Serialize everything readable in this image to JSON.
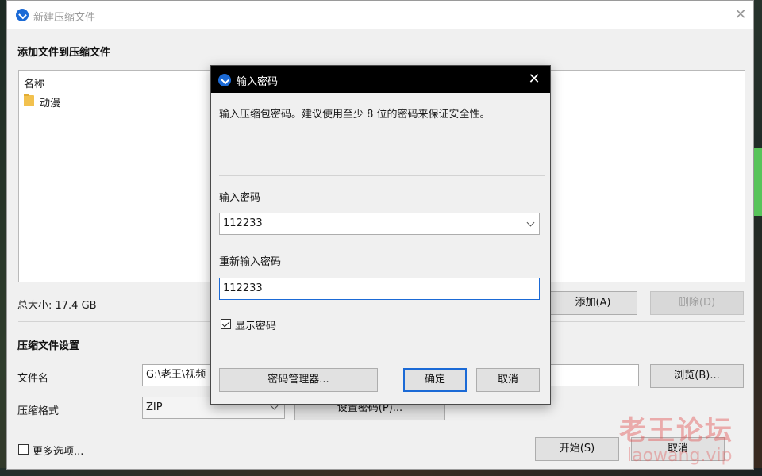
{
  "window": {
    "title": "新建压缩文件",
    "close_glyph": "✕"
  },
  "add_files": {
    "heading": "添加文件到压缩文件",
    "column_name": "名称",
    "items": [
      {
        "name": "动漫",
        "icon": "folder-icon"
      }
    ],
    "total_size": "总大小: 17.4 GB",
    "add_button": "添加(A)",
    "delete_button": "删除(D)"
  },
  "settings": {
    "heading": "压缩文件设置",
    "filename_label": "文件名",
    "filename_value": "G:\\老王\\视频",
    "browse_button": "浏览(B)...",
    "format_label": "压缩格式",
    "format_value": "ZIP",
    "set_password_button": "设置密码(P)...",
    "more_options_label": "更多选项...",
    "more_options_checked": false,
    "start_button": "开始(S)",
    "cancel_button": "取消"
  },
  "password_dialog": {
    "title": "输入密码",
    "close_glyph": "✕",
    "hint": "输入压缩包密码。建议使用至少 8 位的密码来保证安全性。",
    "password_label": "输入密码",
    "password_value": "112233",
    "confirm_label": "重新输入密码",
    "confirm_value": "112233",
    "show_password_label": "显示密码",
    "show_password_checked": true,
    "manager_button": "密码管理器...",
    "ok_button": "确定",
    "cancel_button": "取消"
  },
  "watermark": {
    "text_cn": "老王论坛",
    "text_en": "laowang.vip"
  },
  "colors": {
    "accent": "#1b6ad6",
    "dialog_titlebar": "#000000",
    "watermark": "#e25656"
  }
}
